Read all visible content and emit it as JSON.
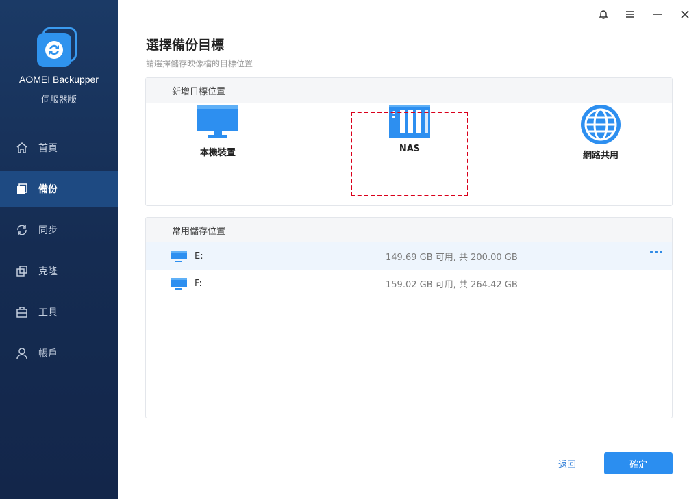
{
  "app": {
    "name": "AOMEI Backupper",
    "edition": "伺服器版"
  },
  "sidebar": {
    "items": [
      {
        "label": "首頁",
        "icon": "home-icon",
        "active": false
      },
      {
        "label": "備份",
        "icon": "backup-icon",
        "active": true
      },
      {
        "label": "同步",
        "icon": "sync-icon",
        "active": false
      },
      {
        "label": "克隆",
        "icon": "clone-icon",
        "active": false
      },
      {
        "label": "工具",
        "icon": "toolbox-icon",
        "active": false
      },
      {
        "label": "帳戶",
        "icon": "account-icon",
        "active": false
      }
    ]
  },
  "titlebar": {
    "icons": [
      "bell-icon",
      "menu-icon",
      "minimize-icon",
      "close-icon"
    ]
  },
  "main": {
    "title": "選擇備份目標",
    "subtitle": "請選擇儲存映像檔的目標位置",
    "add_target": {
      "header": "新增目標位置",
      "options": [
        {
          "label": "本機裝置",
          "icon": "monitor-icon"
        },
        {
          "label": "NAS",
          "icon": "nas-icon",
          "highlighted": true
        },
        {
          "label": "網路共用",
          "icon": "globe-icon"
        }
      ]
    },
    "common": {
      "header": "常用儲存位置",
      "drives": [
        {
          "letter": "E:",
          "size": "149.69 GB 可用, 共 200.00 GB",
          "selected": true
        },
        {
          "letter": "F:",
          "size": "159.02 GB 可用, 共 264.42 GB",
          "selected": false
        }
      ]
    }
  },
  "footer": {
    "back_label": "返回",
    "ok_label": "確定"
  },
  "colors": {
    "accent": "#2b8ef0",
    "sidebar_bg": "#152c52",
    "highlight": "#d9001b"
  }
}
